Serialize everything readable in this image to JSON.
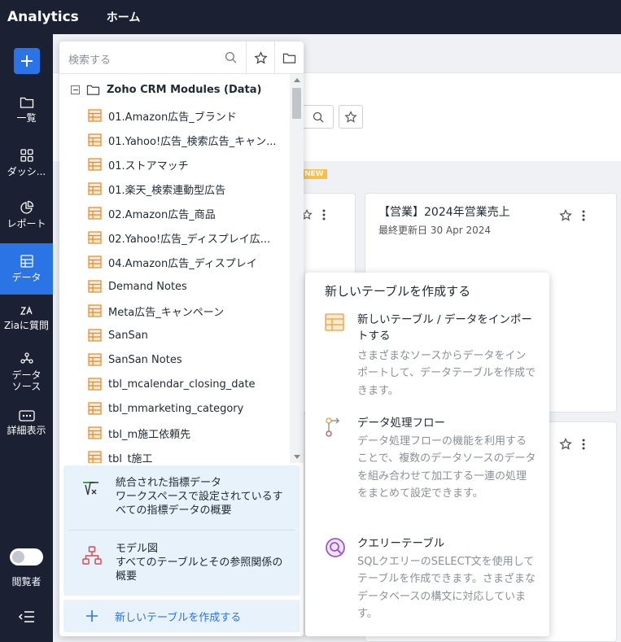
{
  "app": {
    "brand": "Analytics",
    "home": "ホーム"
  },
  "nav": {
    "add_label": "+",
    "items": [
      {
        "label": "一覧",
        "icon": "folder-icon"
      },
      {
        "label": "ダッシ...",
        "icon": "dashboard-grid-icon"
      },
      {
        "label": "レポート",
        "icon": "pie-chart-icon"
      },
      {
        "label": "データ",
        "icon": "table-icon"
      },
      {
        "label": "Ziaに質問",
        "icon": "zia-icon"
      },
      {
        "label": "データソース",
        "icon": "datasource-icon"
      },
      {
        "label": "詳細表示",
        "icon": "more-icon"
      }
    ],
    "viewer_label": "閲覧者"
  },
  "explorer": {
    "search_placeholder": "検索する",
    "root_label": "Zoho CRM Modules (Data)",
    "items": [
      "01.Amazon広告_ブランド",
      "01.Yahoo!広告_検索広告_キャン...",
      "01.ストアマッチ",
      "01.楽天_検索連動型広告",
      "02.Amazon広告_商品",
      "02.Yahoo!広告_ディスプレイ広...",
      "04.Amazon広告_ディスプレイ",
      "Demand Notes",
      "Meta広告_キャンペーン",
      "SanSan",
      "SanSan Notes",
      "tbl_mcalendar_closing_date",
      "tbl_mmarketing_category",
      "tbl_m施工依頼先",
      "tbl_t施工"
    ],
    "metrics": {
      "title": "統合された指標データ",
      "desc": "ワークスペースで設定されているすべての指標データの概要"
    },
    "model": {
      "title": "モデル図",
      "desc": "すべてのテーブルとその参照関係の概要"
    },
    "create_label": "新しいテーブルを作成する"
  },
  "background": {
    "new_badge": "NEW",
    "card_title": "【営業】2024年営業売上",
    "card_meta": "最終更新日 30 Apr 2024"
  },
  "popup": {
    "title": "新しいテーブルを作成する",
    "options": [
      {
        "title": "新しいテーブル / データをインポートする",
        "desc": "さまざまなソースからデータをインポートして、データテーブルを作成できます。",
        "icon": "table-import-icon"
      },
      {
        "title": "データ処理フロー",
        "desc": "データ処理フローの機能を利用することで、複数のデータソースのデータを組み合わせて加工する一連の処理をまとめて設定できます。",
        "icon": "dataflow-icon"
      },
      {
        "title": "クエリーテーブル",
        "desc": "SQLクエリーのSELECT文を使用してテーブルを作成できます。さまざまなデータベースの構文に対応しています。",
        "icon": "query-table-icon"
      }
    ]
  }
}
